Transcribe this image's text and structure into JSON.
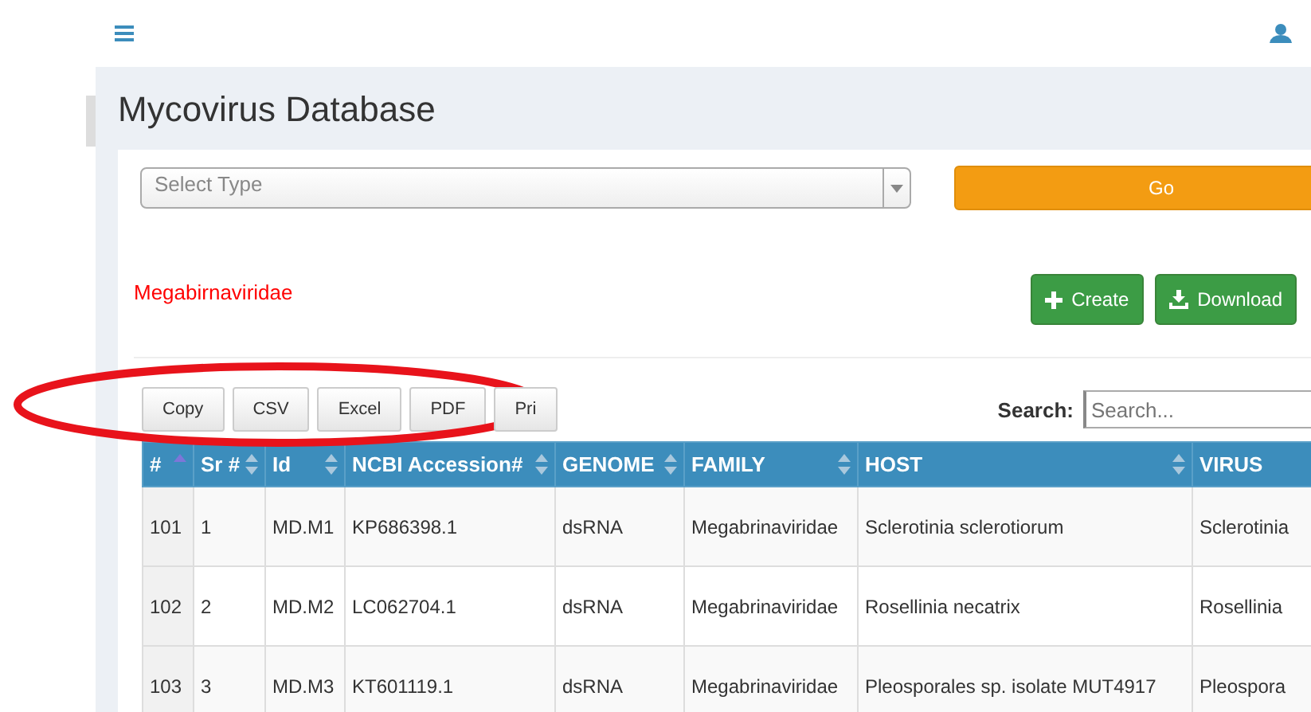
{
  "page_title": "Mycovirus Database",
  "type_select": {
    "placeholder": "Select Type"
  },
  "go_button": "Go",
  "family_label": "Megabirnaviridae",
  "actions": [
    {
      "kind": "create",
      "label": "Create"
    },
    {
      "kind": "download",
      "label": "Download"
    }
  ],
  "export_buttons": [
    "Copy",
    "CSV",
    "Excel",
    "PDF",
    "Pri"
  ],
  "search": {
    "label": "Search:",
    "placeholder": "Search..."
  },
  "table": {
    "columns": [
      {
        "label": "#",
        "sorted": true
      },
      {
        "label": "Sr #",
        "sorted": false
      },
      {
        "label": "Id",
        "sorted": false
      },
      {
        "label": "NCBI Accession#",
        "sorted": false
      },
      {
        "label": "GENOME",
        "sorted": false
      },
      {
        "label": "FAMILY",
        "sorted": false
      },
      {
        "label": "HOST",
        "sorted": false
      },
      {
        "label": "VIRUS"
      }
    ],
    "rows": [
      [
        "101",
        "1",
        "MD.M1",
        "KP686398.1",
        "dsRNA",
        "Megabrinaviridae",
        "Sclerotinia sclerotiorum",
        "Sclerotinia"
      ],
      [
        "102",
        "2",
        "MD.M2",
        "LC062704.1",
        "dsRNA",
        "Megabrinaviridae",
        "Rosellinia necatrix",
        "Rosellinia"
      ],
      [
        "103",
        "3",
        "MD.M3",
        "KT601119.1",
        "dsRNA",
        "Megabrinaviridae",
        "Pleosporales sp. isolate MUT4917",
        "Pleospora"
      ]
    ]
  }
}
